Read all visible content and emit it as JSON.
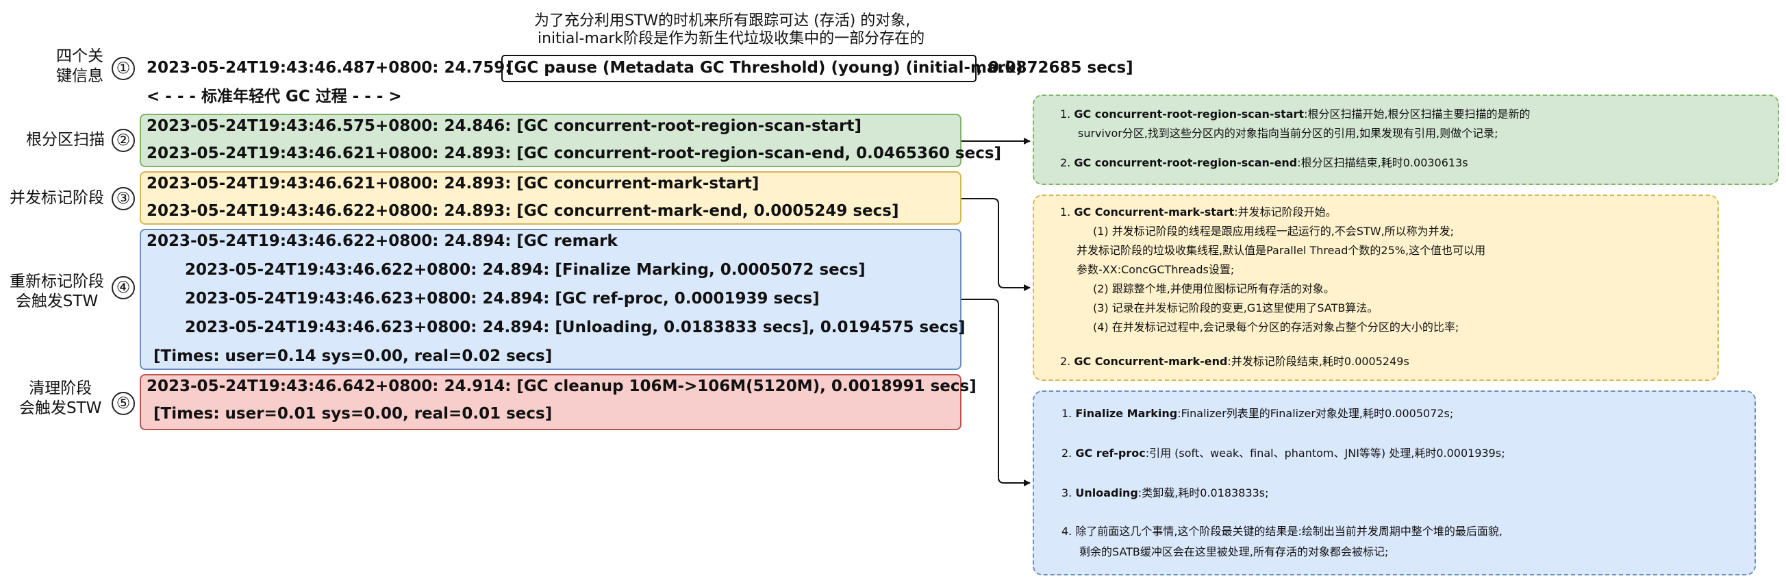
{
  "colors": {
    "green_fill": "#d5e8d4",
    "green_border": "#82b366",
    "yellow_fill": "#fff2cc",
    "yellow_border": "#d6b656",
    "blue_fill": "#dae8fc",
    "blue_border": "#6c8ebf",
    "red_fill": "#f8cecc",
    "red_border": "#b85450"
  },
  "note": {
    "line1": "为了充分利用STW的时机来所有跟踪可达 (存活) 的对象,",
    "line2": "initial-mark阶段是作为新生代垃圾收集中的一部分存在的"
  },
  "stages": [
    {
      "num": "①",
      "label1": "四个关",
      "label2": "键信息"
    },
    {
      "num": "②",
      "label1": "根分区扫描",
      "label2": ""
    },
    {
      "num": "③",
      "label1": "并发标记阶段",
      "label2": ""
    },
    {
      "num": "④",
      "label1": "重新标记阶段",
      "label2": "会触发STW"
    },
    {
      "num": "⑤",
      "label1": "清理阶段",
      "label2": "会触发STW"
    }
  ],
  "logs": {
    "l1_prefix": "2023-05-24T19:43:46.487+0800: 24.759:",
    "l1_boxed": "[GC pause (Metadata GC Threshold) (young) (initial-mark)",
    "l1_suffix": ", 0.0872685 secs]",
    "young_gc": "< - - -  标准年轻代 GC 过程  - - - >",
    "g1": "2023-05-24T19:43:46.575+0800: 24.846: [GC concurrent-root-region-scan-start]",
    "g2": "2023-05-24T19:43:46.621+0800: 24.893: [GC concurrent-root-region-scan-end, 0.0465360 secs]",
    "y1": "2023-05-24T19:43:46.621+0800: 24.893: [GC concurrent-mark-start]",
    "y2": "2023-05-24T19:43:46.622+0800: 24.893: [GC concurrent-mark-end, 0.0005249 secs]",
    "b1": "2023-05-24T19:43:46.622+0800: 24.894: [GC remark",
    "b2": "2023-05-24T19:43:46.622+0800: 24.894: [Finalize Marking, 0.0005072 secs]",
    "b3": "2023-05-24T19:43:46.623+0800: 24.894: [GC ref-proc, 0.0001939 secs]",
    "b4": "2023-05-24T19:43:46.623+0800: 24.894: [Unloading, 0.0183833 secs], 0.0194575 secs]",
    "b5": "[Times: user=0.14 sys=0.00, real=0.02 secs]",
    "r1": "2023-05-24T19:43:46.642+0800: 24.914: [GC cleanup 106M->106M(5120M), 0.0018991 secs]",
    "r2": "[Times: user=0.01 sys=0.00, real=0.01 secs]"
  },
  "panel_green": {
    "i1_num": "1.",
    "i1_title": "GC concurrent-root-region-scan-start",
    "i1_text": ":根分区扫描开始,根分区扫描主要扫描的是新的",
    "i1_text2": "survivor分区,找到这些分区内的对象指向当前分区的引用,如果发现有引用,则做个记录;",
    "i2_num": "2.",
    "i2_title": "GC concurrent-root-region-scan-end",
    "i2_text": ":根分区扫描结束,耗时0.0030613s"
  },
  "panel_yellow": {
    "i1_num": "1.",
    "i1_title": "GC Concurrent-mark-start",
    "i1_text": ":并发标记阶段开始。",
    "s1": "(1) 并发标记阶段的线程是跟应用线程一起运行的,不会STW,所以称为并发;",
    "s1b": "并发标记阶段的垃圾收集线程,默认值是Parallel Thread个数的25%,这个值也可以用",
    "s1c": "参数-XX:ConcGCThreads设置;",
    "s2": "(2) 跟踪整个堆,并使用位图标记所有存活的对象。",
    "s3": "(3) 记录在并发标记阶段的变更,G1这里使用了SATB算法。",
    "s4": "(4) 在并发标记过程中,会记录每个分区的存活对象占整个分区的大小的比率;",
    "i2_num": "2.",
    "i2_title": "GC Concurrent-mark-end",
    "i2_text": ":并发标记阶段结束,耗时0.0005249s"
  },
  "panel_blue": {
    "i1_num": "1.",
    "i1_title": "Finalize Marking",
    "i1_text": ":Finalizer列表里的Finalizer对象处理,耗时0.0005072s;",
    "i2_num": "2.",
    "i2_title": "GC ref-proc",
    "i2_text": ":引用 (soft、weak、final、phantom、JNI等等) 处理,耗时0.0001939s;",
    "i3_num": "3.",
    "i3_title": "Unloading",
    "i3_text": ":类卸载,耗时0.0183833s;",
    "i4_num": "4.",
    "i4_text": "除了前面这几个事情,这个阶段最关键的结果是:绘制出当前并发周期中整个堆的最后面貌,",
    "i4_text2": "剩余的SATB缓冲区会在这里被处理,所有存活的对象都会被标记;"
  }
}
